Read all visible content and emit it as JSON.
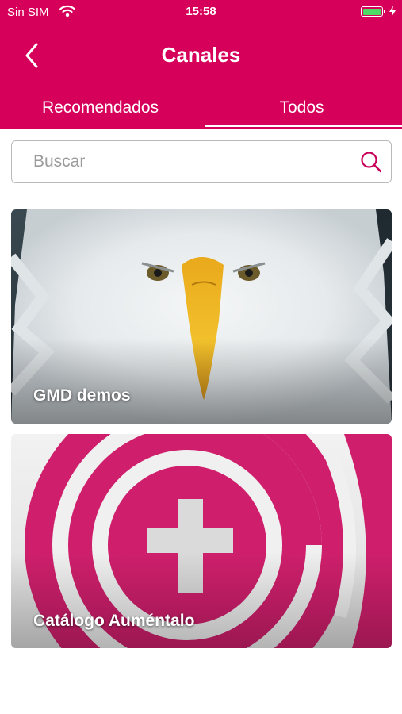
{
  "status_bar": {
    "carrier": "Sin SIM",
    "time": "15:58",
    "battery_level": 1.0
  },
  "nav": {
    "title": "Canales"
  },
  "tabs": [
    {
      "label": "Recomendados",
      "selected": false
    },
    {
      "label": "Todos",
      "selected": true
    }
  ],
  "search": {
    "placeholder": "Buscar",
    "value": ""
  },
  "channels": [
    {
      "name": "GMD demos",
      "image": "eagle-photo"
    },
    {
      "name": "Catálogo Auméntalo",
      "image": "aumentalo-logo"
    }
  ],
  "colors": {
    "brand": "#d6005a",
    "search_icon": "#c8005a",
    "battery": "#4cd964"
  }
}
